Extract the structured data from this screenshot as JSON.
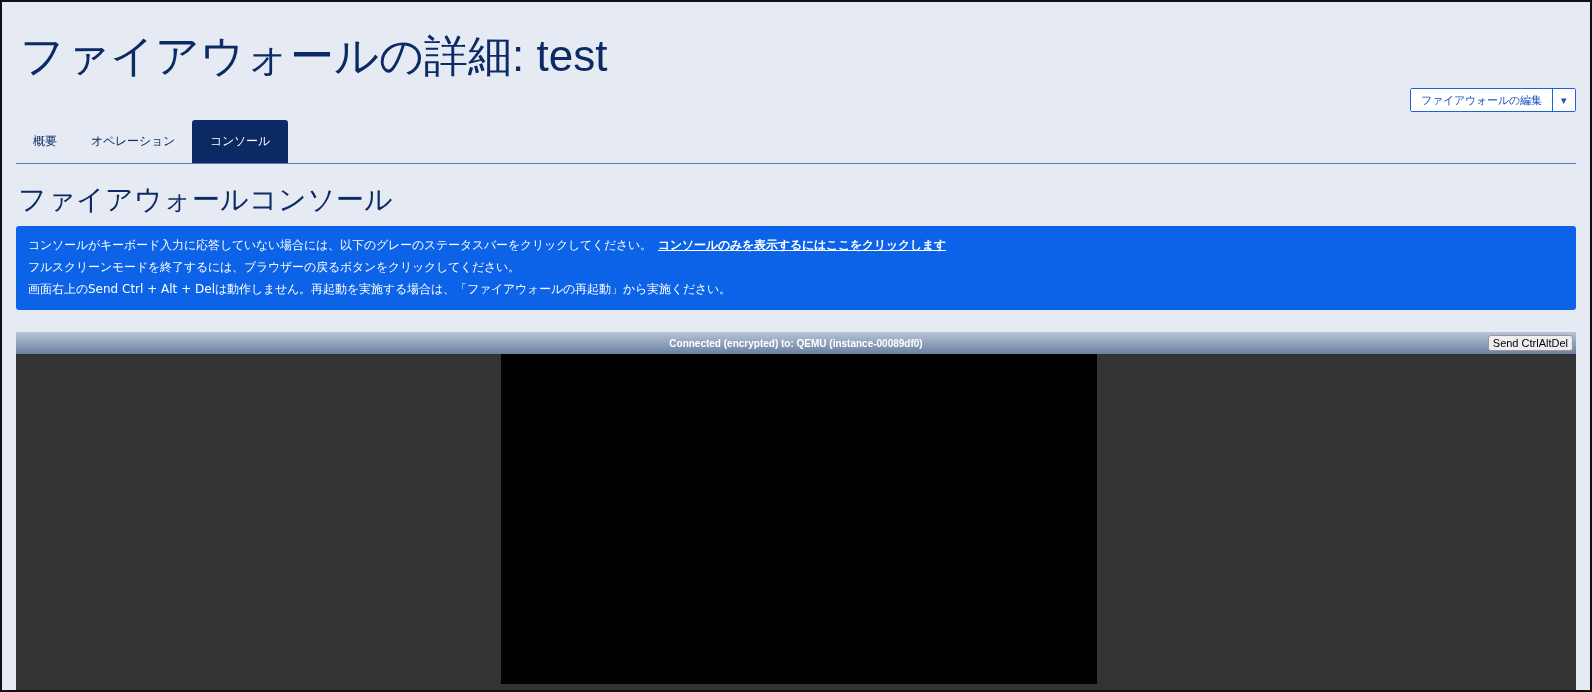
{
  "page_title": "ファイアウォールの詳細: test",
  "edit_button": {
    "label": "ファイアウォールの編集",
    "caret": "▾"
  },
  "tabs": [
    {
      "label": "概要",
      "selected": false
    },
    {
      "label": "オペレーション",
      "selected": false
    },
    {
      "label": "コンソール",
      "selected": true
    }
  ],
  "section_title": "ファイアウォールコンソール",
  "notice": [
    {
      "text": "コンソールがキーボード入力に応答していない場合には、以下のグレーのステータスバーをクリックしてください。",
      "link": "コンソールのみを表示するにはここをクリックします"
    },
    {
      "text": "フルスクリーンモードを終了するには、ブラウザーの戻るボタンをクリックしてください。"
    },
    {
      "text": "画面右上のSend Ctrl + Alt + Delは動作しません。再起動を実施する場合は、「ファイアウォールの再起動」から実施ください。"
    }
  ],
  "console": {
    "status": "Connected (encrypted) to: QEMU (instance-00089df0)",
    "send_button": "Send CtrlAltDel"
  }
}
